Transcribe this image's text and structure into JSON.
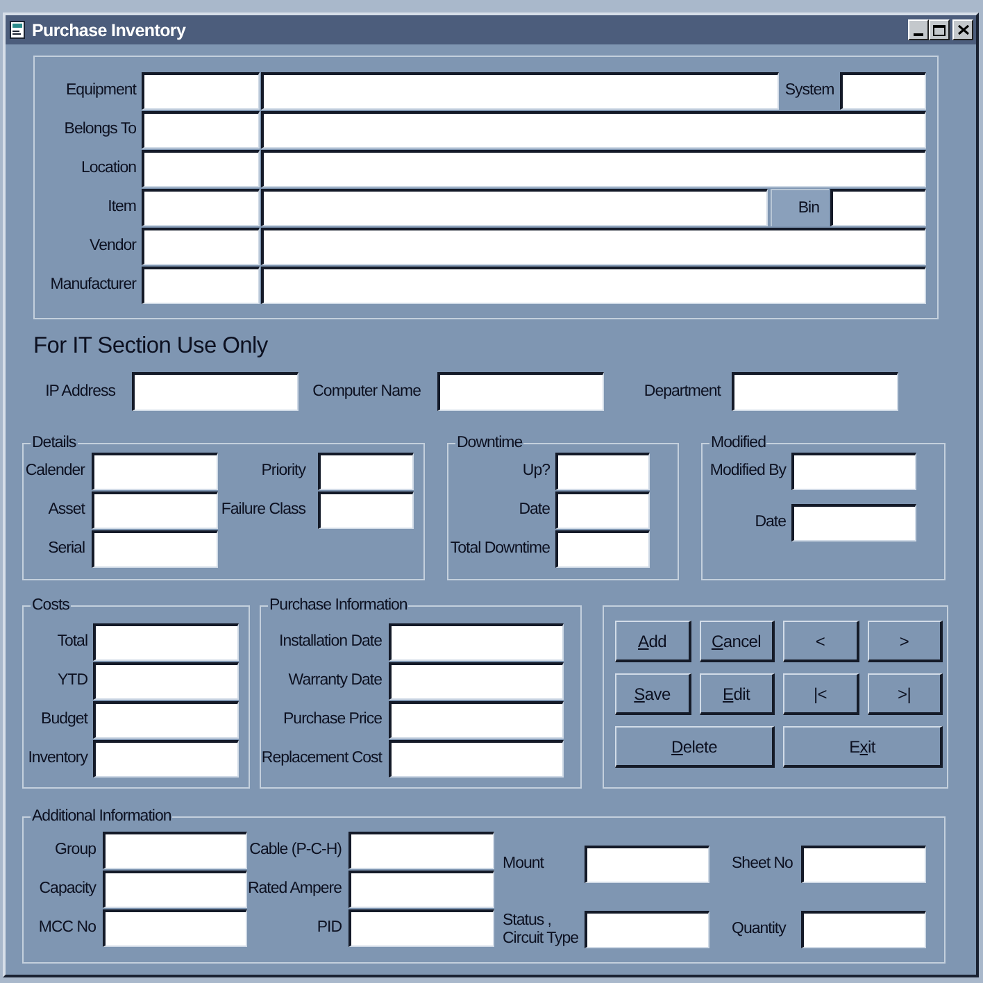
{
  "window": {
    "title": "Purchase Inventory"
  },
  "main_rows": [
    {
      "label": "Equipment",
      "side": {
        "kind": "label",
        "label": "System"
      }
    },
    {
      "label": "Belongs To"
    },
    {
      "label": "Location"
    },
    {
      "label": "Item",
      "side": {
        "kind": "boxed",
        "label": "Bin"
      }
    },
    {
      "label": "Vendor"
    },
    {
      "label": "Manufacturer"
    }
  ],
  "it_section": {
    "heading": "For IT Section Use Only",
    "fields": [
      {
        "label": "IP Address"
      },
      {
        "label": "Computer Name"
      },
      {
        "label": "Department"
      }
    ]
  },
  "details": {
    "title": "Details",
    "columns": [
      [
        {
          "label": "Calender"
        },
        {
          "label": "Asset"
        },
        {
          "label": "Serial"
        }
      ],
      [
        {
          "label": "Priority"
        },
        {
          "label": "Failure Class"
        }
      ]
    ]
  },
  "downtime": {
    "title": "Downtime",
    "fields": [
      {
        "label": "Up?"
      },
      {
        "label": "Date"
      },
      {
        "label": "Total Downtime"
      }
    ]
  },
  "modified": {
    "title": "Modified",
    "fields": [
      {
        "label": "Modified By"
      },
      {
        "label": "Date"
      }
    ]
  },
  "costs": {
    "title": "Costs",
    "fields": [
      {
        "label": "Total"
      },
      {
        "label": "YTD"
      },
      {
        "label": "Budget"
      },
      {
        "label": "Inventory"
      }
    ]
  },
  "purchase_information": {
    "title": "Purchase Information",
    "fields": [
      {
        "label": "Installation Date"
      },
      {
        "label": "Warranty Date"
      },
      {
        "label": "Purchase Price"
      },
      {
        "label": "Replacement Cost"
      }
    ]
  },
  "button_rows": [
    [
      {
        "label": "Add",
        "underlined": [
          true,
          false,
          false
        ]
      },
      {
        "label": "Cancel",
        "underlined": [
          true,
          false,
          false,
          false,
          false,
          false
        ]
      },
      {
        "label": "<"
      },
      {
        "label": ">"
      }
    ],
    [
      {
        "label": "Save",
        "underlined": [
          true,
          false,
          false,
          false
        ]
      },
      {
        "label": "Edit",
        "underlined": [
          true,
          false,
          false,
          false
        ]
      },
      {
        "label": "|<"
      },
      {
        "label": ">|"
      }
    ],
    [
      {
        "label": "Delete",
        "underlined": [
          true,
          false,
          false,
          false,
          false,
          false
        ]
      },
      {
        "label": "Exit",
        "underlined": [
          false,
          true,
          false,
          false
        ]
      }
    ]
  ],
  "additional_information": {
    "title": "Additional Information",
    "columns": [
      [
        {
          "label": "Group"
        },
        {
          "label": "Capacity"
        },
        {
          "label": "MCC No"
        }
      ],
      [
        {
          "label": "Cable (P-C-H)"
        },
        {
          "label": "Rated Ampere"
        },
        {
          "label": "PID"
        }
      ],
      [
        {
          "label": "Mount"
        },
        {
          "label": "Status ,\nCircuit Type"
        }
      ],
      [
        {
          "label": "Sheet No"
        },
        {
          "label": "Quantity"
        }
      ]
    ]
  }
}
